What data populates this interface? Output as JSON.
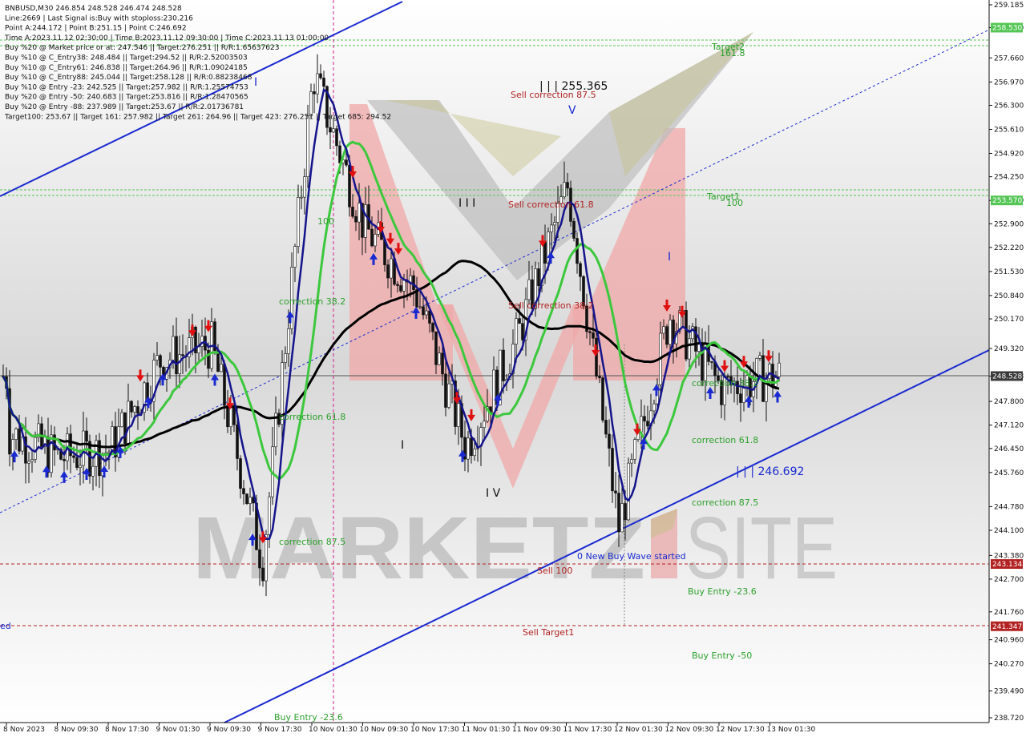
{
  "info_lines": [
    "BNBUSD,M30  246.854 248.528 246.474 248.528",
    "Line:2669 | Last Signal is:Buy with stoploss:230.216",
    "Point A:244.172 | Point B:251.15 | Point C:246.692",
    "Time A:2023.11.12 02:30:00 | Time B:2023.11.12 09:30:00 | Time C:2023.11.13 01:00:00",
    "Buy %20 @ Market price or at: 247.546 || Target:276.251 || R/R:1.65637623",
    "Buy %10 @ C_Entry38: 248.484 || Target:294.52 || R/R:2.52003503",
    "Buy %10 @ C_Entry61: 246.838 || Target:264.96 || R/R:1.09024185",
    "Buy %10 @ C_Entry88: 245.044 || Target:258.128 || R/R:0.88238468",
    "Buy %10 @ Entry -23: 242.525 || Target:257.982 || R/R:1.25574753",
    "Buy %20 @ Entry -50: 240.683 || Target:253.816 || R/R:1.28470565",
    "Buy %20 @ Entry -88: 237.989 || Target:253.67 || R/R:2.01736781",
    "Target100: 253.67 || Target 161: 257.982 || Target 261: 264.96 || Target 423: 276.251 || Target 685: 294.52"
  ],
  "watermark": {
    "left": "MARKETZ",
    "right": "SITE"
  },
  "y_ticks": [
    "259.185",
    "258.530",
    "257.660",
    "256.970",
    "256.300",
    "255.610",
    "254.920",
    "254.250",
    "253.570",
    "252.900",
    "252.220",
    "251.530",
    "250.840",
    "250.170",
    "249.320",
    "248.528",
    "247.800",
    "247.120",
    "246.450",
    "245.760",
    "244.780",
    "244.100",
    "243.380",
    "242.700",
    "241.760",
    "240.960",
    "240.270",
    "239.490",
    "238.720"
  ],
  "y_highlights": [
    {
      "label": "258.530",
      "color": "#55c655",
      "stacked": "258.530"
    },
    {
      "label": "253.570",
      "color": "#55c655",
      "stacked": "253.570"
    },
    {
      "label": "248.528",
      "color": "#3a3a3a"
    },
    {
      "label": "243.134",
      "color": "#b22222"
    },
    {
      "label": "241.347",
      "color": "#b22222"
    }
  ],
  "x_ticks": [
    "8 Nov 2023",
    "8 Nov 09:30",
    "8 Nov 17:30",
    "9 Nov 01:30",
    "9 Nov 09:30",
    "9 Nov 17:30",
    "10 Nov 01:30",
    "10 Nov 09:30",
    "10 Nov 17:30",
    "11 Nov 01:30",
    "11 Nov 09:30",
    "11 Nov 17:30",
    "12 Nov 01:30",
    "12 Nov 09:30",
    "12 Nov 17:30",
    "13 Nov 01:30"
  ],
  "annotations": {
    "target2": "Target2",
    "t161": "161.8",
    "target1": "Target1",
    "t100": "100",
    "peak_price": "| | | 255.365",
    "sell_corr_875": "Sell correction 87.5",
    "sell_corr_618": "Sell correction 61.8",
    "sell_corr_382": "Sell correction 38.2",
    "corr_382_left": "correction 38.2",
    "corr_618_left": "correction 61.8",
    "corr_875_left": "correction 87.5",
    "corr_382_right": "correction 38.2",
    "corr_618_right": "correction 61.8",
    "corr_875_right": "correction 87.5",
    "low_price": "| | | 246.692",
    "new_buy_wave": "0 New Buy Wave started",
    "sell_100": "Sell 100",
    "sell_target1": "Sell Target1",
    "buy_entry_236_right": "Buy Entry -23.6",
    "buy_entry_50": "Buy Entry -50",
    "buy_entry_236_left": "Buy Entry -23.6",
    "wave_iii": "I I I",
    "wave_iv": "I V",
    "wave_v": "V",
    "wave_i": "I",
    "left_edge_label": "ed",
    "left_100": "100"
  },
  "colors": {
    "buy_arrow": "#1a2ad0",
    "sell_arrow": "#e01010",
    "ma_green": "#3cc83c",
    "ma_blue": "#14148c",
    "ma_black": "#000000",
    "channel": "#1a2ad0",
    "target_green": "#55c655",
    "level_red": "#b22222"
  },
  "chart_data": {
    "type": "candlestick",
    "symbol": "BNBUSD",
    "timeframe": "M30",
    "ohlc_last": {
      "open": 246.854,
      "high": 248.528,
      "low": 246.474,
      "close": 248.528
    },
    "ylim": [
      238.72,
      259.185
    ],
    "key_points": [
      {
        "x": "8 Nov 2023",
        "y": 246.9
      },
      {
        "x": "8 Nov 09:30",
        "y": 246.2
      },
      {
        "x": "8 Nov 17:30",
        "y": 246.4
      },
      {
        "x": "9 Nov 01:30",
        "y": 249.0
      },
      {
        "x": "9 Nov 09:30",
        "y": 249.4
      },
      {
        "x": "9 Nov 17:30",
        "y": 243.2
      },
      {
        "x": "10 Nov 01:30",
        "y": 257.2
      },
      {
        "x": "10 Nov 09:30",
        "y": 252.8
      },
      {
        "x": "10 Nov 17:30",
        "y": 251.0
      },
      {
        "x": "11 Nov 01:30",
        "y": 246.5
      },
      {
        "x": "11 Nov 09:30",
        "y": 249.6
      },
      {
        "x": "11 Nov 17:30",
        "y": 254.0
      },
      {
        "x": "12 Nov 01:30",
        "y": 244.2
      },
      {
        "x": "12 Nov 09:30",
        "y": 250.3
      },
      {
        "x": "12 Nov 17:30",
        "y": 248.2
      },
      {
        "x": "13 Nov 01:30",
        "y": 248.528
      }
    ],
    "levels": [
      {
        "name": "Target2",
        "value": 258.53
      },
      {
        "name": "Target1",
        "value": 253.57
      },
      {
        "name": "Sell 100",
        "value": 243.134
      },
      {
        "name": "Sell Target1",
        "value": 241.347
      }
    ]
  }
}
